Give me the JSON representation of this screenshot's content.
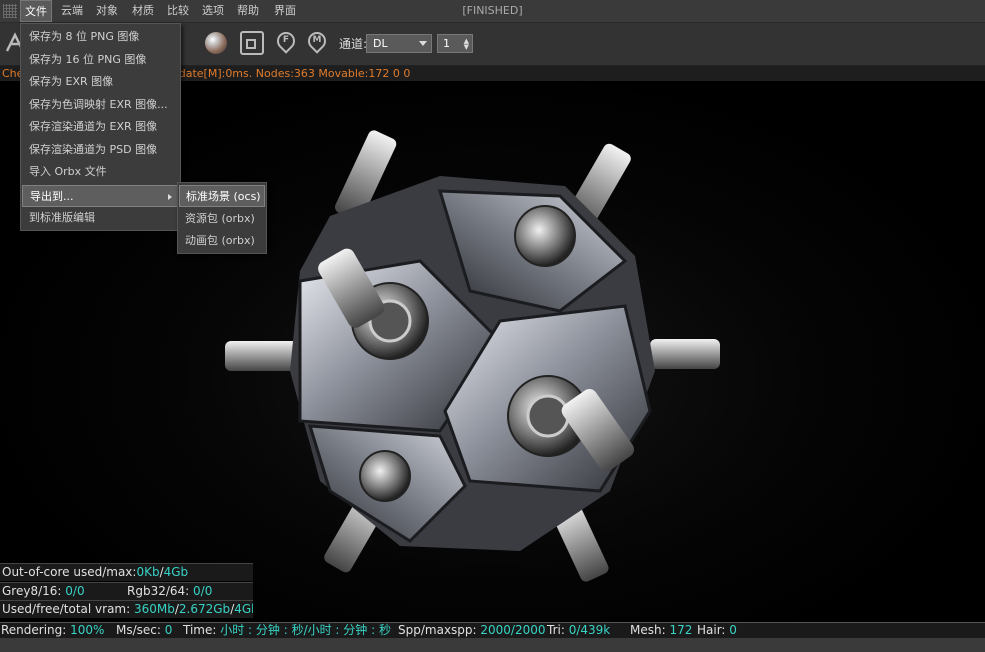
{
  "window": {
    "title": "[FINISHED]"
  },
  "menubar": {
    "items": [
      "文件",
      "云端",
      "对象",
      "材质",
      "比较",
      "选项",
      "帮助",
      "界面"
    ],
    "active_index": 0
  },
  "toolbar": {
    "icons": [
      "render-settings-icon",
      "material-sphere-icon",
      "region-icon",
      "pin-f-icon",
      "pin-m-icon"
    ],
    "pin_f_letter": "F",
    "pin_m_letter": "M",
    "channel_label": "通道:",
    "channel_value": "DL",
    "spin_value": "1"
  },
  "statusline": {
    "left_text": "Che",
    "right_text": "odate[M]:0ms. Nodes:363 Movable:172  0 0"
  },
  "file_menu": {
    "items": [
      "保存为 8 位 PNG 图像",
      "保存为 16 位 PNG 图像",
      "保存为 EXR 图像",
      "保存为色调映射 EXR 图像...",
      "保存渲染通道为 EXR 图像",
      "保存渲染通道为 PSD 图像",
      "导入 Orbx 文件",
      "导出到...",
      "到标准版编辑"
    ],
    "highlighted_index": 7
  },
  "export_submenu": {
    "items": [
      "标准场景 (ocs)",
      "资源包 (orbx)",
      "动画包 (orbx)"
    ],
    "highlighted_index": 0
  },
  "stats": {
    "out_of_core_label": "Out-of-core used/max:",
    "out_of_core_used": "0Kb",
    "out_of_core_sep": "/",
    "out_of_core_max": "4Gb",
    "grey_label": "Grey8/16: ",
    "grey_value": "0/0",
    "rgb_label": "Rgb32/64: ",
    "rgb_value": "0/0",
    "vram_label": "Used/free/total vram: ",
    "vram_used": "360Mb",
    "vram_sep1": "/",
    "vram_free": "2.672Gb",
    "vram_sep2": "/",
    "vram_total": "4Gb"
  },
  "bottom": {
    "rendering_label": "Rendering: ",
    "rendering_value": "100%",
    "ms_label": "Ms/sec: ",
    "ms_value": "0",
    "time_label": "Time: ",
    "time_value": "小时 : 分钟 : 秒/小时 : 分钟 : 秒",
    "spp_label": "Spp/maxspp: ",
    "spp_value": "2000/2000",
    "tri_label": "Tri: ",
    "tri_value": "0/439k",
    "mesh_label": "Mesh: ",
    "mesh_value": "172",
    "hair_label": "Hair: ",
    "hair_value": "0"
  }
}
